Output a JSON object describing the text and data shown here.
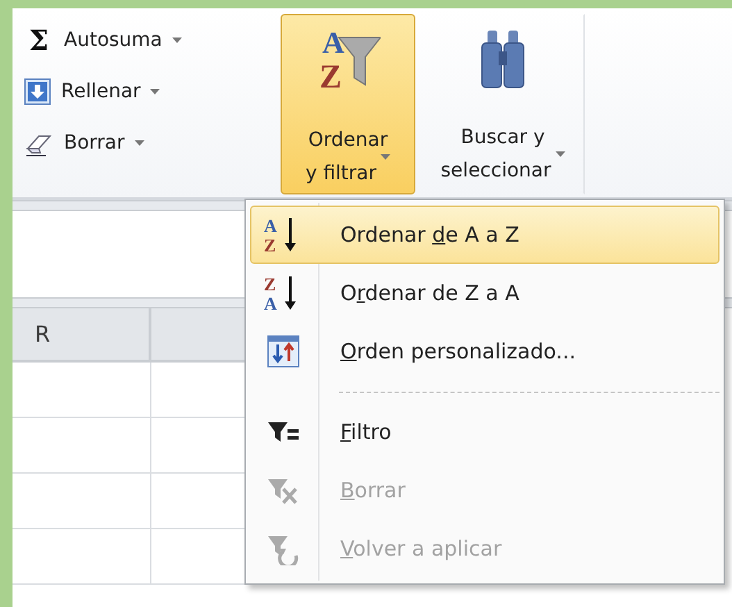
{
  "ribbon": {
    "small_buttons": [
      {
        "kind": "sum",
        "icon": "Σ",
        "label": "Autosuma"
      },
      {
        "kind": "fill",
        "label": "Rellenar"
      },
      {
        "kind": "clear",
        "label": "Borrar"
      }
    ],
    "big_buttons": [
      {
        "kind": "sort",
        "icon_top": "A",
        "icon_bottom": "Z",
        "line1": "Ordenar",
        "line2": "y filtrar",
        "selected": true
      },
      {
        "kind": "find",
        "line1": "Buscar y",
        "line2": "seleccionar",
        "selected": false
      }
    ]
  },
  "sheet": {
    "columns": [
      "R"
    ]
  },
  "menu": {
    "items": [
      {
        "kind": "sort_az",
        "icon_top": "A",
        "icon_bottom": "Z",
        "before": "Ordenar ",
        "key": "d",
        "after": "e A a Z",
        "selected": true,
        "disabled": false
      },
      {
        "kind": "sort_za",
        "icon_top": "Z",
        "icon_bottom": "A",
        "before": "O",
        "key": "r",
        "after": "denar de Z a A",
        "selected": false,
        "disabled": false
      },
      {
        "kind": "custom",
        "key": "O",
        "after": "rden personalizado...",
        "selected": false,
        "disabled": false
      },
      {
        "kind": "separator"
      },
      {
        "kind": "filter",
        "key": "F",
        "after": "iltro",
        "selected": false,
        "disabled": false
      },
      {
        "kind": "clear",
        "key": "B",
        "after": "orrar",
        "selected": false,
        "disabled": true
      },
      {
        "kind": "reapply",
        "key": "V",
        "after": "olver a aplicar",
        "selected": false,
        "disabled": true
      }
    ]
  }
}
